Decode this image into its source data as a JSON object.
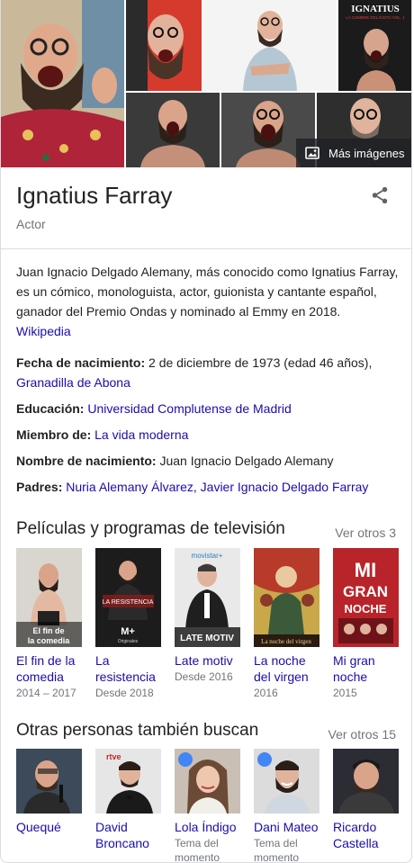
{
  "images": {
    "more_label": "Más imágenes",
    "poster_text_1": "IGNATIUS",
    "poster_text_2": "LA CUMBRE DEL ÉXITO VOL. 1"
  },
  "header": {
    "title": "Ignatius Farray",
    "subtitle": "Actor"
  },
  "description": {
    "text": "Juan Ignacio Delgado Alemany, más conocido como Ignatius Farray, es un cómico, monologuista, actor, guionista y cantante español,  ganador del Premio Ondas y nominado al Emmy en 2018.",
    "source": "Wikipedia"
  },
  "facts": {
    "birth_label": "Fecha de nacimiento:",
    "birth_value": "2 de diciembre de 1973 (edad 46 años),",
    "birth_place": "Granadilla de Abona",
    "education_label": "Educación:",
    "education_value": "Universidad Complutense de Madrid",
    "member_label": "Miembro de:",
    "member_value": "La vida moderna",
    "birthname_label": "Nombre de nacimiento:",
    "birthname_value": "Juan Ignacio Delgado Alemany",
    "parents_label": "Padres:",
    "parent_1": "Nuria Alemany Álvarez",
    "parent_sep": ",",
    "parent_2": "Javier Ignacio Delgado Farray"
  },
  "films": {
    "title": "Películas y programas de televisión",
    "more": "Ver otros 3",
    "items": [
      {
        "name": "El fin de la comedia",
        "sub": "2014 – 2017",
        "overlay": "El fin de la comedia"
      },
      {
        "name": "La resistencia",
        "sub": "Desde 2018",
        "overlay": "LA RESISTENCIA",
        "logo": "Originales"
      },
      {
        "name": "Late motiv",
        "sub": "Desde 2016",
        "overlay": "LATE MOTIV",
        "logo": "movistar+"
      },
      {
        "name": "La noche del virgen",
        "sub": "2016",
        "overlay": "La noche del virgen"
      },
      {
        "name": "Mi gran noche",
        "sub": "2015",
        "overlay": "MI GRAN NOCHE"
      }
    ]
  },
  "people": {
    "title": "Otras personas también buscan",
    "more": "Ver otros 15",
    "items": [
      {
        "name": "Quequé",
        "sub": ""
      },
      {
        "name": "David Broncano",
        "sub": ""
      },
      {
        "name": "Lola Índigo",
        "sub": "Tema del momento"
      },
      {
        "name": "Dani Mateo",
        "sub": "Tema del momento"
      },
      {
        "name": "Ricardo Castella",
        "sub": ""
      }
    ]
  },
  "colors": {
    "link": "#1a0dab",
    "muted": "#70757a",
    "text": "#222222",
    "badge": "#4285f4"
  }
}
